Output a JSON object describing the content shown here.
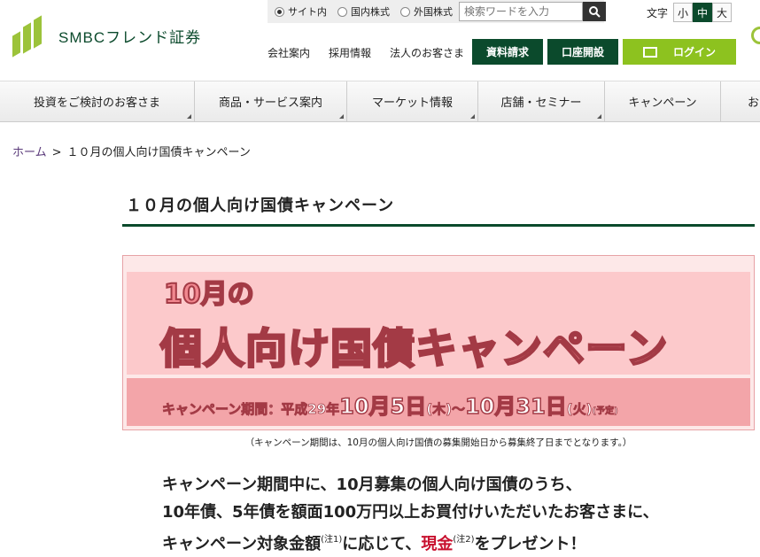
{
  "brand": {
    "name": "SMBCフレンド証券"
  },
  "search": {
    "radios": [
      {
        "label": "サイト内",
        "selected": true
      },
      {
        "label": "国内株式",
        "selected": false
      },
      {
        "label": "外国株式",
        "selected": false
      }
    ],
    "placeholder": "検索ワードを入力",
    "icon": "search-icon"
  },
  "font_size": {
    "label": "文字",
    "options": [
      "小",
      "中",
      "大"
    ],
    "selected": "中"
  },
  "util_links": [
    "会社案内",
    "採用情報",
    "法人のお客さま"
  ],
  "buttons": {
    "shiryo": "資料請求",
    "koza": "口座開設",
    "login": "ログイン"
  },
  "nav": [
    {
      "label": "投資をご検討のお客さま"
    },
    {
      "label": "商品・サービス案内"
    },
    {
      "label": "マーケット情報"
    },
    {
      "label": "店舗・セミナー"
    },
    {
      "label": "キャンペーン"
    },
    {
      "label": "お"
    }
  ],
  "breadcrumb": {
    "home": "ホーム",
    "separator": ">",
    "current": "１０月の個人向け国債キャンペーン"
  },
  "page_title": "１０月の個人向け国債キャンペーン",
  "banner": {
    "line1": "10月の",
    "line2": "個人向け国債キャンペーン",
    "period_label": "キャンペーン期間：平成29年",
    "start_date": "10月5日",
    "start_day": "(木)",
    "tilde": "～",
    "end_date": "10月31日",
    "end_day": "(火)",
    "tentative": "(予定)"
  },
  "banner_note": "（キャンペーン期間は、10月の個人向け国債の募集開始日から募集終了日までとなります。）",
  "lead": {
    "line1": "キャンペーン期間中に、10月募集の個人向け国債のうち、",
    "line2": "10年債、5年債を額面100万円以上お買付けいただいたお客さまに、",
    "line3_a": "キャンペーン対象金額",
    "note1": "(注1)",
    "line3_b": "に応じて、",
    "cash": "現金",
    "note2": "(注2)",
    "line3_c": "をプレゼント！"
  },
  "colors": {
    "brand_green": "#0b4a2c",
    "accent_green": "#8dc21f",
    "banner_pink": "#fcc9cb",
    "highlight_red": "#c8102e"
  }
}
